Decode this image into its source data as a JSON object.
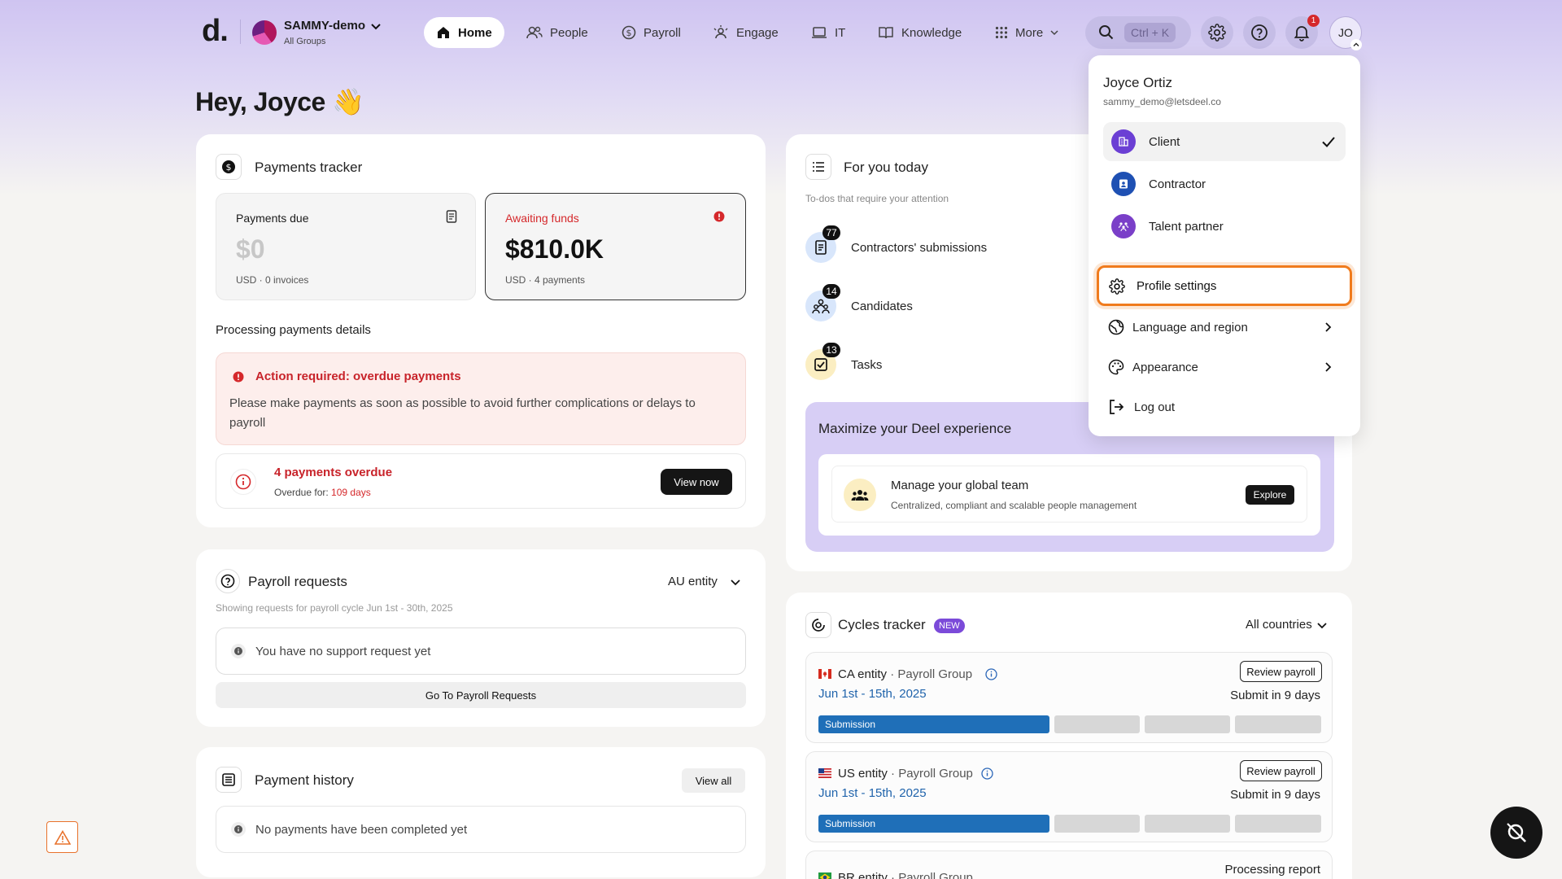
{
  "org": {
    "name": "SAMMY-demo",
    "subtitle": "All Groups"
  },
  "nav": {
    "items": [
      {
        "label": "Home",
        "icon": "home-icon"
      },
      {
        "label": "People",
        "icon": "people-icon"
      },
      {
        "label": "Payroll",
        "icon": "payroll-icon"
      },
      {
        "label": "Engage",
        "icon": "engage-icon"
      },
      {
        "label": "IT",
        "icon": "laptop-icon"
      },
      {
        "label": "Knowledge",
        "icon": "book-icon"
      },
      {
        "label": "More",
        "icon": "grid-icon"
      }
    ],
    "search_shortcut": "Ctrl + K",
    "notification_count": "1",
    "avatar_initials": "JO"
  },
  "greeting": "Hey, Joyce 👋",
  "payments_tracker": {
    "title": "Payments tracker",
    "due": {
      "label": "Payments due",
      "amount": "$0",
      "meta": "USD · 0 invoices"
    },
    "awaiting": {
      "label": "Awaiting funds",
      "amount": "$810.0K",
      "meta": "USD · 4 payments"
    },
    "details_heading": "Processing payments details",
    "alert": {
      "title": "Action required: overdue payments",
      "body": "Please make payments as soon as possible to avoid further complications or delays to payroll"
    },
    "overdue": {
      "title": "4 payments overdue",
      "for_label": "Overdue for:",
      "days": "109 days",
      "button": "View now"
    }
  },
  "payroll_requests": {
    "title": "Payroll requests",
    "entity": "AU entity",
    "subtitle": "Showing requests for payroll cycle Jun 1st - 30th, 2025",
    "empty": "You have no support request yet",
    "button": "Go To Payroll Requests"
  },
  "payment_history": {
    "title": "Payment history",
    "button": "View all",
    "empty": "No payments have been completed yet"
  },
  "for_you": {
    "title": "For you today",
    "subtitle": "To-dos that require your attention",
    "items": [
      {
        "label": "Contractors' submissions",
        "count": "77"
      },
      {
        "label": "Candidates",
        "count": "14"
      },
      {
        "label": "Tasks",
        "count": "13"
      }
    ],
    "promo": {
      "title": "Maximize your Deel experience",
      "item_title": "Manage your global team",
      "item_desc": "Centralized, compliant and scalable people management",
      "button": "Explore"
    }
  },
  "cycles": {
    "title": "Cycles tracker",
    "badge": "NEW",
    "filter": "All countries",
    "rows": [
      {
        "entity": "CA entity",
        "group": "· Payroll Group",
        "dates": "Jun 1st - 15th, 2025",
        "button": "Review payroll",
        "submit": "Submit in 9 days",
        "stage": "Submission"
      },
      {
        "entity": "US entity",
        "group": "· Payroll Group",
        "dates": "Jun 1st - 15th, 2025",
        "button": "Review payroll",
        "submit": "Submit in 9 days",
        "stage": "Submission"
      },
      {
        "entity": "BR entity",
        "group": "· Payroll Group",
        "status": "Processing report"
      }
    ]
  },
  "profile_menu": {
    "name": "Joyce Ortiz",
    "email": "sammy_demo@letsdeel.co",
    "roles": [
      {
        "label": "Client",
        "selected": true,
        "color": "#6b3fd4"
      },
      {
        "label": "Contractor",
        "selected": false,
        "color": "#1e50b3"
      },
      {
        "label": "Talent partner",
        "selected": false,
        "color": "#7a3fc8"
      }
    ],
    "actions": [
      {
        "label": "Profile settings",
        "icon": "gear-icon"
      },
      {
        "label": "Language and region",
        "icon": "globe-icon"
      },
      {
        "label": "Appearance",
        "icon": "palette-icon"
      },
      {
        "label": "Log out",
        "icon": "logout-icon"
      }
    ],
    "highlight_color": "#f07b1d"
  }
}
